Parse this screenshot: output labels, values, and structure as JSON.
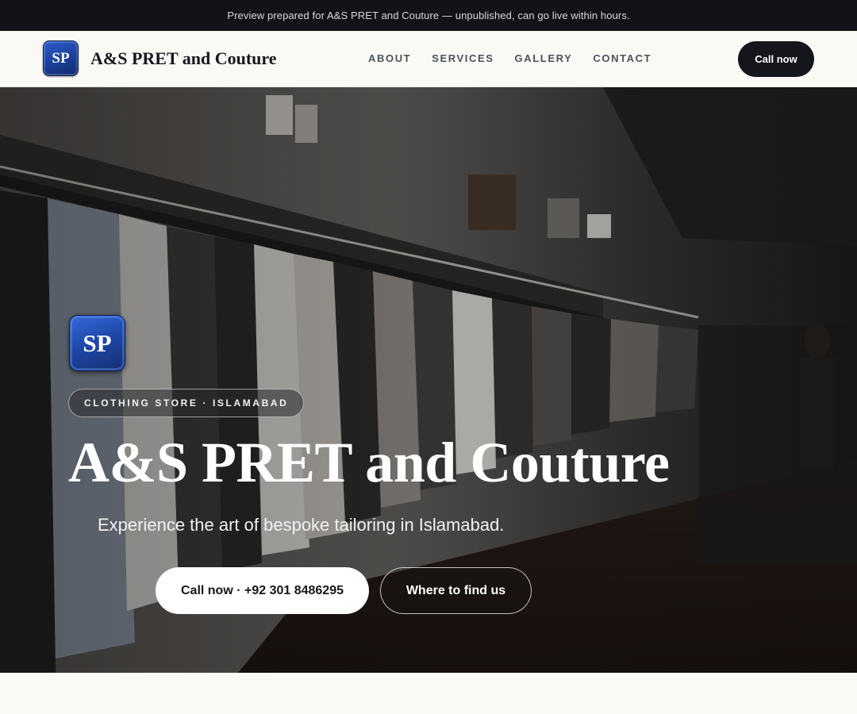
{
  "banner": {
    "text": "Preview prepared for A&S PRET and Couture — unpublished, can go live within hours."
  },
  "header": {
    "logo_text": "SP",
    "brand_name": "A&S PRET and Couture",
    "nav": [
      "ABOUT",
      "SERVICES",
      "GALLERY",
      "CONTACT"
    ],
    "call_label": "Call now"
  },
  "hero": {
    "logo_text": "SP",
    "tag": "CLOTHING STORE · ISLAMABAD",
    "title": "A&S PRET and Couture",
    "subtitle": "Experience the art of bespoke tailoring in Islamabad.",
    "primary_cta": "Call now · +92 301 8486295",
    "secondary_cta": "Where to find us"
  },
  "colors": {
    "banner_bg": "#111318",
    "header_bg": "#faf9f6",
    "dark_button": "#14161b",
    "logo_blue": "#1d47a6"
  },
  "icons": {
    "logo": "sp-monogram-badge"
  }
}
